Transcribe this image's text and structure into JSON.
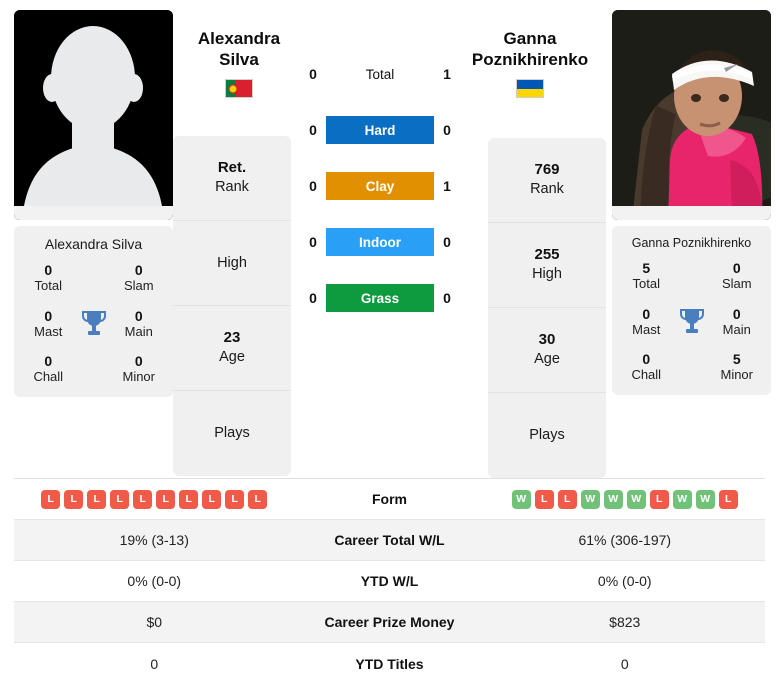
{
  "players": {
    "left": {
      "first_name": "Alexandra",
      "last_name": "Silva",
      "full_name": "Alexandra Silva",
      "flag": "portugal-flag",
      "photo": "player-placeholder-silhouette",
      "titles": {
        "total": "0",
        "total_label": "Total",
        "slam": "0",
        "slam_label": "Slam",
        "mast": "0",
        "mast_label": "Mast",
        "main": "0",
        "main_label": "Main",
        "chall": "0",
        "chall_label": "Chall",
        "minor": "0",
        "minor_label": "Minor"
      },
      "info": [
        {
          "value": "Ret.",
          "label": "Rank"
        },
        {
          "value": "",
          "label": "High"
        },
        {
          "value": "23",
          "label": "Age"
        },
        {
          "value": "",
          "label": "Plays"
        }
      ],
      "form": [
        "L",
        "L",
        "L",
        "L",
        "L",
        "L",
        "L",
        "L",
        "L",
        "L"
      ]
    },
    "right": {
      "first_name": "Ganna",
      "last_name": "Poznikhirenko",
      "full_name": "Ganna Poznikhirenko",
      "flag": "ukraine-flag",
      "photo": "player-photo",
      "titles": {
        "total": "5",
        "total_label": "Total",
        "slam": "0",
        "slam_label": "Slam",
        "mast": "0",
        "mast_label": "Mast",
        "main": "0",
        "main_label": "Main",
        "chall": "0",
        "chall_label": "Chall",
        "minor": "5",
        "minor_label": "Minor"
      },
      "info": [
        {
          "value": "769",
          "label": "Rank"
        },
        {
          "value": "255",
          "label": "High"
        },
        {
          "value": "30",
          "label": "Age"
        },
        {
          "value": "",
          "label": "Plays"
        }
      ],
      "form": [
        "W",
        "L",
        "L",
        "W",
        "W",
        "W",
        "L",
        "W",
        "W",
        "L"
      ]
    }
  },
  "surfaces": [
    {
      "label": "Total",
      "left": "0",
      "right": "1",
      "color": ""
    },
    {
      "label": "Hard",
      "left": "0",
      "right": "0",
      "color": "#0a6fc2"
    },
    {
      "label": "Clay",
      "left": "0",
      "right": "1",
      "color": "#e09000"
    },
    {
      "label": "Indoor",
      "left": "0",
      "right": "0",
      "color": "#29a0f5"
    },
    {
      "label": "Grass",
      "left": "0",
      "right": "0",
      "color": "#0e9a3e"
    }
  ],
  "stats_table": {
    "rows": [
      {
        "label": "Form",
        "left": "",
        "right": ""
      },
      {
        "label": "Career Total W/L",
        "left": "19% (3-13)",
        "right": "61% (306-197)"
      },
      {
        "label": "YTD W/L",
        "left": "0% (0-0)",
        "right": "0% (0-0)"
      },
      {
        "label": "Career Prize Money",
        "left": "$0",
        "right": "$823"
      },
      {
        "label": "YTD Titles",
        "left": "0",
        "right": "0"
      }
    ]
  },
  "colors": {
    "win": "#71c278",
    "loss": "#ef5b48",
    "hard": "#0a6fc2",
    "clay": "#e09000",
    "indoor": "#29a0f5",
    "grass": "#0e9a3e",
    "trophy": "#4a7fbf",
    "card_bg": "#f0f0f0"
  }
}
